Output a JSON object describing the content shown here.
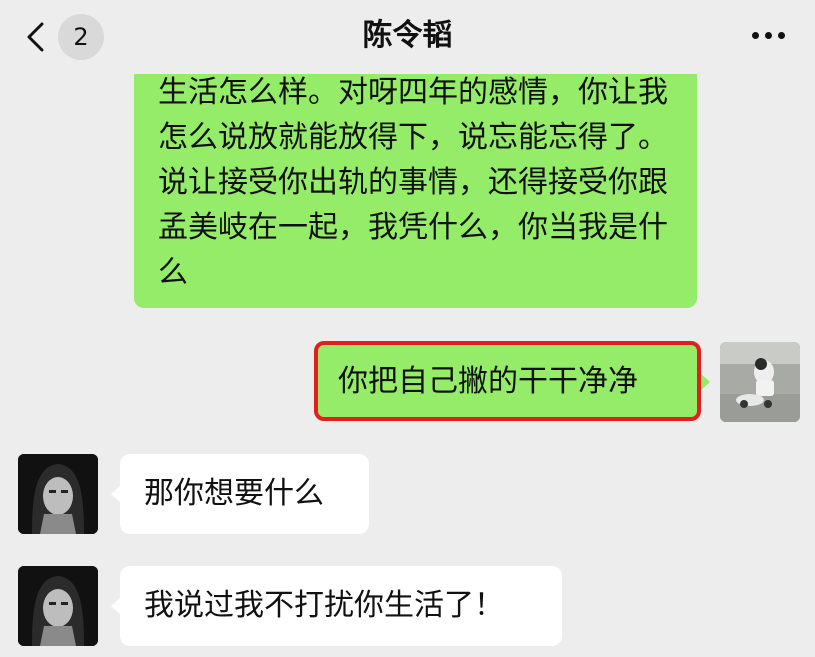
{
  "header": {
    "back_badge": "2",
    "title": "陈令韬"
  },
  "messages": {
    "long_text": "生活怎么样。对呀四年的感情，你让我怎么说放就能放得下，说忘能忘得了。说让接受你出轨的事情，还得接受你跟孟美岐在一起，我凭什么，你当我是什么",
    "self_text": "你把自己撇的干干净净",
    "other_1": "那你想要什么",
    "other_2": "我说过我不打扰你生活了！"
  },
  "colors": {
    "background": "#ededed",
    "self_bubble": "#95ec69",
    "other_bubble": "#ffffff",
    "highlight_border": "#e02020"
  },
  "icons": {
    "back": "chevron-left-icon",
    "more": "more-dots-icon"
  }
}
